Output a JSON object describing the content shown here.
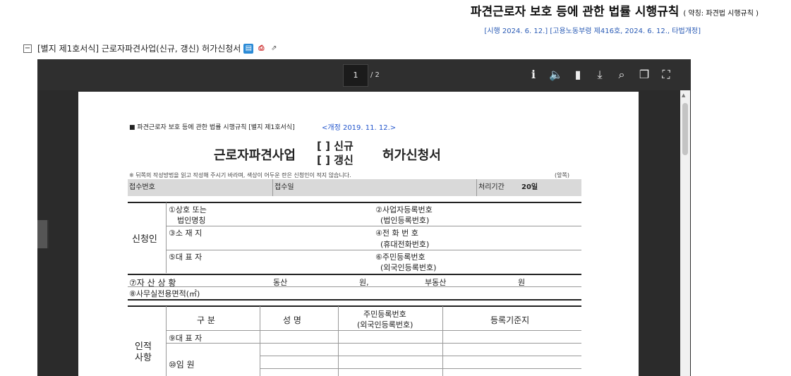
{
  "header": {
    "title": "파견근로자 보호 등에 관한 법률 시행규칙",
    "abbr": "( 약칭: 파견법 시행규칙 )",
    "enforcement": "[시행 2024. 6. 12.] [고용노동부령 제416호, 2024. 6. 12., 타법개정]"
  },
  "form_line": {
    "label": "[별지 제1호서식] 근로자파견사업(신규, 갱신) 허가신청서",
    "collapse": "−"
  },
  "viewer": {
    "page_current": "1",
    "page_total": "/ 2",
    "icons": [
      "info-icon",
      "speaker-icon",
      "panel-icon",
      "download-icon",
      "search-icon",
      "copy-icon",
      "fullscreen-icon"
    ]
  },
  "document": {
    "law_ref": "■ 파견근로자 보호 등에 관한 법률 시행규칙 [별지 제1호서식]",
    "revision": "<개정 2019. 11. 12.>",
    "title_main": "근로자파견사업",
    "opt_new": "[  ] 신규",
    "opt_renew": "[  ] 갱신",
    "title_end": "허가신청서",
    "note": "※ 뒤쪽의 작성방법을 읽고 작성해 주시기 바라며, 색상이 어두운 란은 신청인이 적지 않습니다.",
    "front": "(앞쪽)",
    "receipt_no": "접수번호",
    "receipt_date": "접수일",
    "period_label": "처리기간",
    "period_value": "20일",
    "applicant": "신청인",
    "f1a": "①상호 또는",
    "f1b": "법인명칭",
    "f2a": "②사업자등록번호",
    "f2b": "(법인등록번호)",
    "f3": "③소 재 지",
    "f4a": "④전 화 번 호",
    "f4b": "(휴대전화번호)",
    "f5": "⑤대 표 자",
    "f6a": "⑥주민등록번호",
    "f6b": "(외국인등록번호)",
    "f7": "⑦자 산 상 황",
    "movable": "동산",
    "won1": "원,",
    "immovable": "부동산",
    "won2": "원",
    "f8": "⑧사무실전용면적(㎡)",
    "personal1": "인적",
    "personal2": "사항",
    "col_type": "구   분",
    "col_name": "성   명",
    "col_rrn1": "주민등록번호",
    "col_rrn2": "(외국인등록번호)",
    "col_criteria": "등록기준지",
    "f9": "⑨대 표 자",
    "f10": "⑩임     원"
  }
}
